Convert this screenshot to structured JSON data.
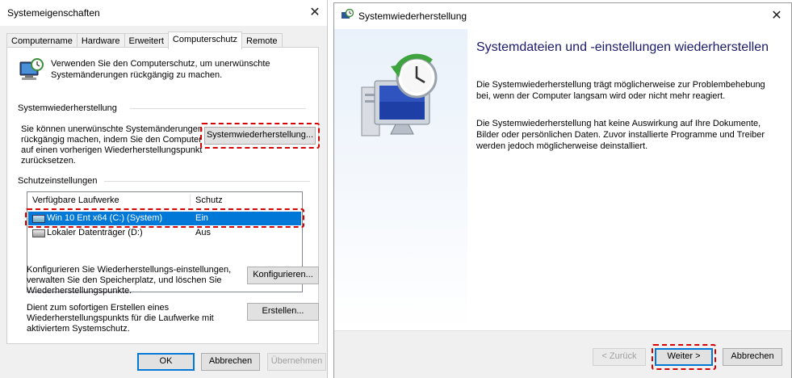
{
  "left_window": {
    "title": "Systemeigenschaften",
    "close_glyph": "✕",
    "tabs": [
      "Computername",
      "Hardware",
      "Erweitert",
      "Computerschutz",
      "Remote"
    ],
    "active_tab": "Computerschutz",
    "intro_text": "Verwenden Sie den Computerschutz, um unerwünschte Systemänderungen rückgängig zu machen.",
    "restore_section_label": "Systemwiederherstellung",
    "restore_desc": "Sie können unerwünschte Systemänderungen rückgängig machen, indem Sie den Computer auf einen vorherigen Wiederherstellungspunkt zurücksetzen.",
    "restore_button": "Systemwiederherstellung...",
    "protection_section_label": "Schutzeinstellungen",
    "drives_table": {
      "columns": [
        "Verfügbare Laufwerke",
        "Schutz"
      ],
      "rows": [
        {
          "name": "Win 10 Ent x64 (C:) (System)",
          "protection": "Ein",
          "selected": true
        },
        {
          "name": "Lokaler Datenträger (D:)",
          "protection": "Aus",
          "selected": false
        }
      ]
    },
    "configure_desc": "Konfigurieren Sie Wiederherstellungs-einstellungen, verwalten Sie den Speicherplatz, und löschen Sie Wiederherstellungspunkte.",
    "configure_button": "Konfigurieren...",
    "create_desc": "Dient zum sofortigen Erstellen eines Wiederherstellungspunkts für die Laufwerke mit aktiviertem Systemschutz.",
    "create_button": "Erstellen...",
    "ok_button": "OK",
    "cancel_button": "Abbrechen",
    "apply_button": "Übernehmen"
  },
  "right_window": {
    "title": "Systemwiederherstellung",
    "close_glyph": "✕",
    "heading": "Systemdateien und -einstellungen wiederherstellen",
    "paragraph1": "Die Systemwiederherstellung trägt möglicherweise zur Problembehebung bei, wenn der Computer langsam wird oder nicht mehr reagiert.",
    "paragraph2": "Die Systemwiederherstellung hat keine Auswirkung auf Ihre Dokumente, Bilder oder persönlichen Daten. Zuvor installierte Programme und Treiber werden jedoch möglicherweise deinstalliert.",
    "back_button": "< Zurück",
    "next_button": "Weiter >",
    "cancel_button": "Abbrechen"
  },
  "colors": {
    "highlight_dash": "#d50000",
    "selection": "#0078d7",
    "heading": "#1a1a6a"
  },
  "icons": [
    "system-protection-icon",
    "drive-icon",
    "system-restore-clock-icon",
    "close-icon"
  ]
}
